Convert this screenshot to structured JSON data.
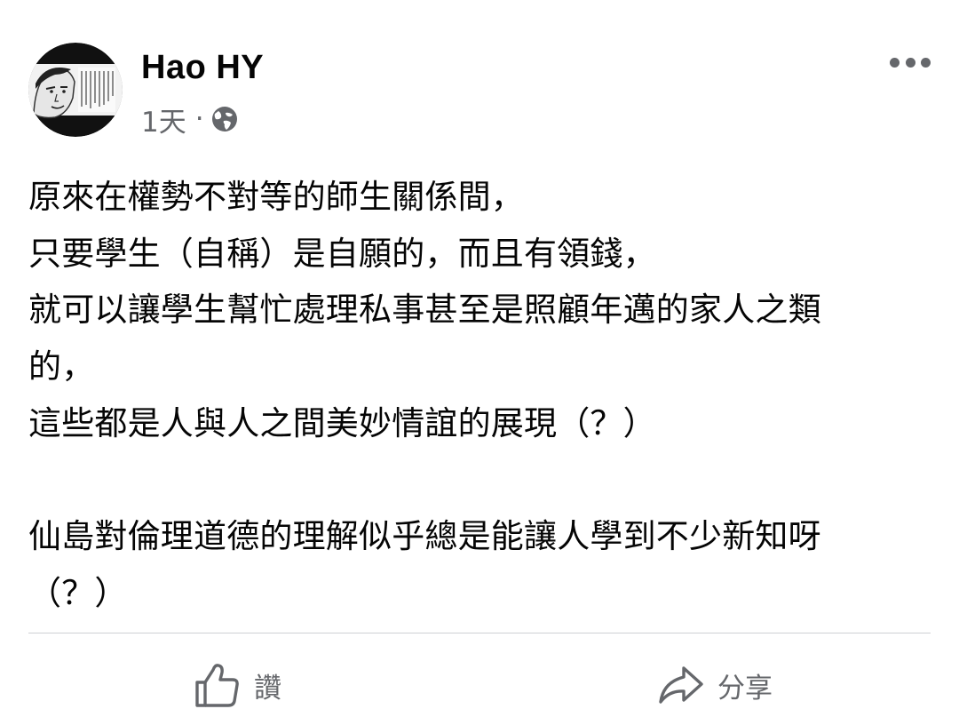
{
  "post": {
    "author": "Hao HY",
    "timestamp": "1天",
    "separator": "·",
    "audience_icon": "globe-icon",
    "more_icon": "more-options-icon",
    "lines": [
      "原來在權勢不對等的師生關係間，",
      "只要學生（自稱）是自願的，而且有領錢，",
      "就可以讓學生幫忙處理私事甚至是照顧年邁的家人之類",
      "的，",
      "這些都是人與人之間美妙情誼的展現（？）",
      "",
      "仙島對倫理道德的理解似乎總是能讓人學到不少新知呀",
      "（？）"
    ]
  },
  "actions": {
    "like_label": "讚",
    "like_icon": "thumbs-up-icon",
    "share_label": "分享",
    "share_icon": "share-arrow-icon"
  },
  "colors": {
    "text": "#050505",
    "secondary": "#65676b",
    "divider": "#ced0d4"
  }
}
